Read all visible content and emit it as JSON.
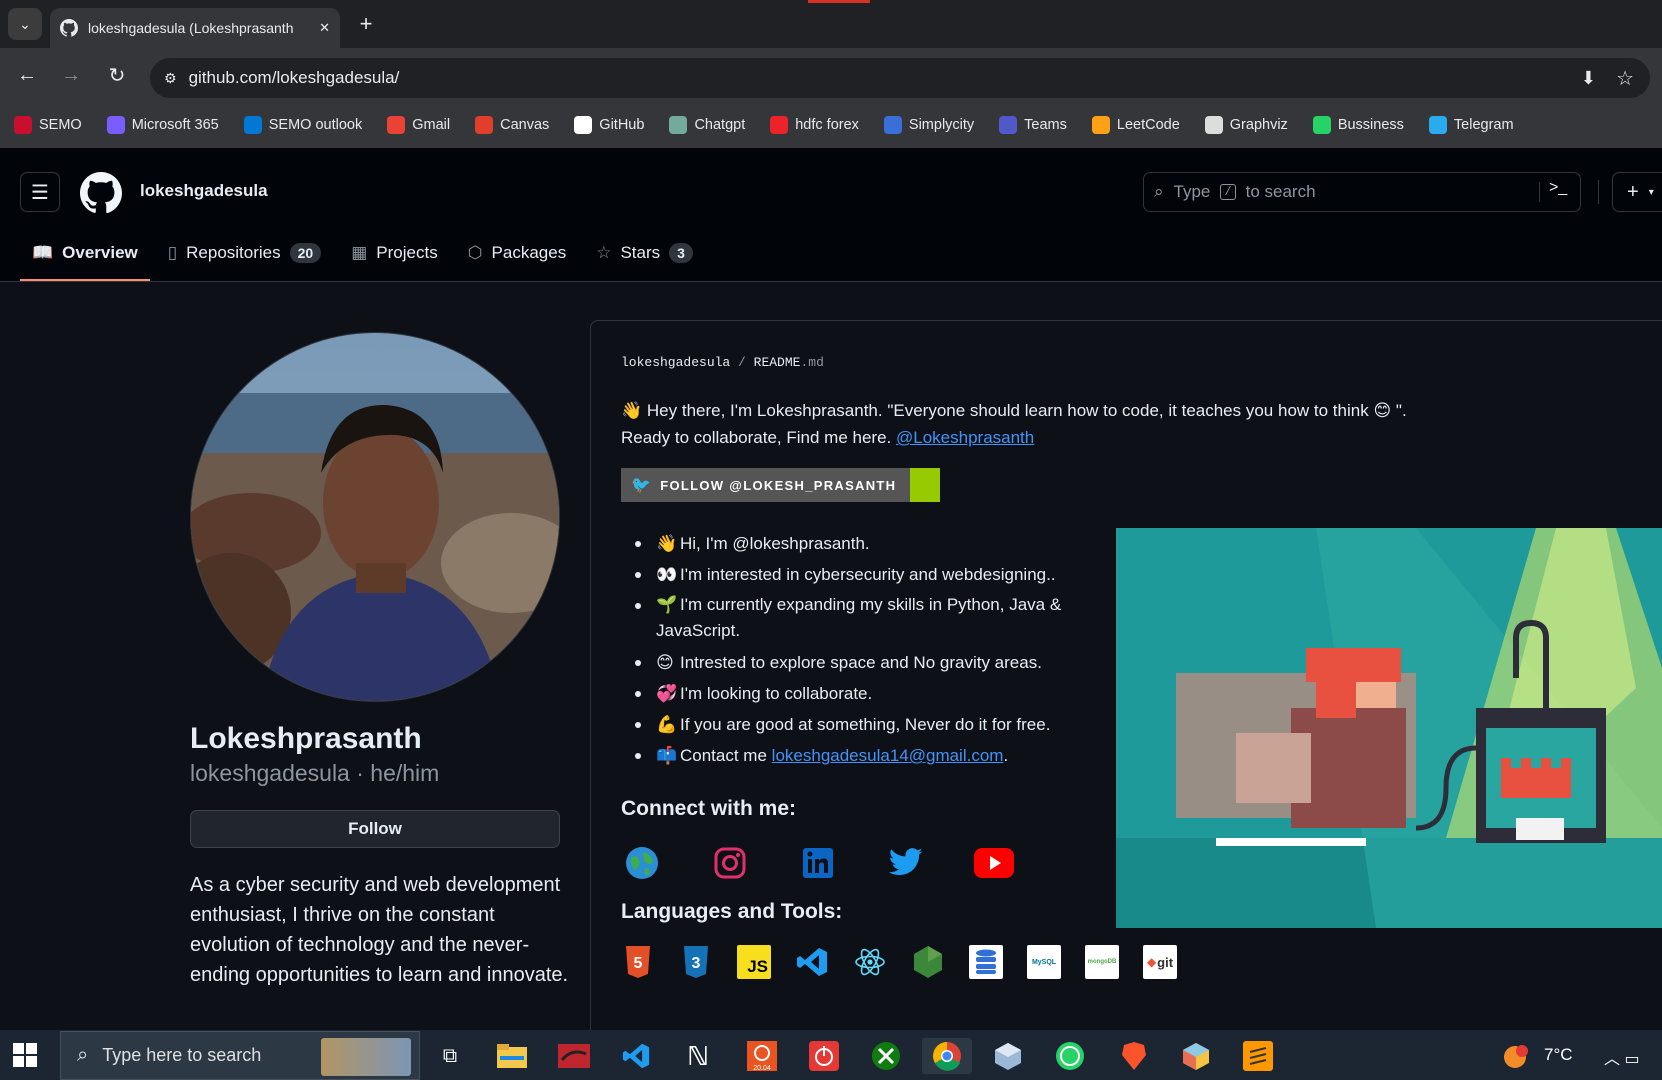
{
  "browser": {
    "tab_title": "lokeshgadesula (Lokeshprasanth",
    "url": "github.com/lokeshgadesula/",
    "bookmarks": [
      {
        "label": "SEMO",
        "color": "#c8102e"
      },
      {
        "label": "Microsoft 365",
        "color": "#7b5cff"
      },
      {
        "label": "SEMO outlook",
        "color": "#0078d4"
      },
      {
        "label": "Gmail",
        "color": "#ea4335"
      },
      {
        "label": "Canvas",
        "color": "#e13f2b"
      },
      {
        "label": "GitHub",
        "color": "#ffffff"
      },
      {
        "label": "Chatgpt",
        "color": "#74aa9c"
      },
      {
        "label": "hdfc forex",
        "color": "#ed232a"
      },
      {
        "label": "Simplycity",
        "color": "#3b6fd8"
      },
      {
        "label": "Teams",
        "color": "#5059c9"
      },
      {
        "label": "LeetCode",
        "color": "#ffa116"
      },
      {
        "label": "Graphviz",
        "color": "#dddddd"
      },
      {
        "label": "Bussiness",
        "color": "#25d366"
      },
      {
        "label": "Telegram",
        "color": "#2aabee"
      }
    ]
  },
  "github": {
    "username": "lokeshgadesula",
    "search_pre": "Type",
    "search_key": "/",
    "search_post": "to search",
    "tabs": [
      {
        "label": "Overview",
        "icon": "book-icon"
      },
      {
        "label": "Repositories",
        "count": "20",
        "icon": "repo-icon"
      },
      {
        "label": "Projects",
        "icon": "table-icon"
      },
      {
        "label": "Packages",
        "icon": "package-icon"
      },
      {
        "label": "Stars",
        "count": "3",
        "icon": "star-icon"
      }
    ]
  },
  "profile": {
    "name": "Lokeshprasanth",
    "login_line": "lokeshgadesula · he/him",
    "follow_label": "Follow",
    "bio": "As a cyber security and web development enthusiast, I thrive on the constant evolution of technology and the never-ending opportunities to learn and innovate."
  },
  "readme": {
    "path_user": "lokeshgadesula",
    "path_sep": "/",
    "path_file": "README",
    "path_ext": ".md",
    "intro_line1": "Hey there, I'm Lokeshprasanth. \"Everyone should learn how to code, it teaches you how to think",
    "intro_line1_end": "\".",
    "intro_line2": "Ready to collaborate, Find me here.",
    "intro_link": "@Lokeshprasanth",
    "twitter_badge": "FOLLOW @LOKESH_PRASANTH",
    "bullets": [
      {
        "emoji": "👋",
        "text": "Hi, I'm @lokeshprasanth."
      },
      {
        "emoji": "👀",
        "text": "I'm interested in cybersecurity and webdesigning.."
      },
      {
        "emoji": "🌱",
        "text": "I'm currently expanding my skills in Python, Java & JavaScript."
      },
      {
        "emoji": "😊",
        "text": "Intrested to explore space and No gravity areas."
      },
      {
        "emoji": "💞",
        "text": "I'm looking to collaborate."
      },
      {
        "emoji": "💪",
        "text": "If you are good at something, Never do it for free."
      },
      {
        "emoji": "📫",
        "text": "Contact me"
      }
    ],
    "contact_email": "lokeshgadesula14@gmail.com",
    "contact_end": ".",
    "connect_heading": "Connect with me:",
    "lang_heading": "Languages and Tools:",
    "lang_labels": {
      "js": "JS",
      "git": "git",
      "mysql": "MySQL",
      "mongo": "mongoDB"
    }
  },
  "taskbar": {
    "search_placeholder": "Type here to search",
    "weather": "7°C",
    "ubuntu_badge": "20.04"
  }
}
